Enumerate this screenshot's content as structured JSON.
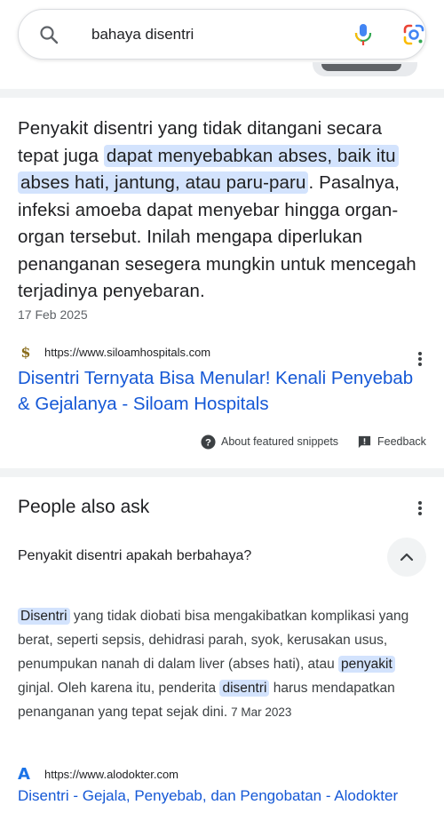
{
  "search": {
    "query": "bahaya disentri",
    "search_icon": "search-icon",
    "mic_icon": "mic-icon",
    "lens_icon": "google-lens-icon"
  },
  "snippet": {
    "before": "Penyakit disentri yang tidak ditangani secara tepat juga ",
    "highlight": "dapat menyebabkan abses, baik itu abses hati, jantung, atau paru-paru",
    "after": ". Pasalnya, infeksi amoeba dapat menyebar hingga organ-organ tersebut. Inilah mengapa diperlukan penanganan sesegera mungkin untuk mencegah terjadinya penyebaran.",
    "date": "17 Feb 2025"
  },
  "result1": {
    "favicon": "$",
    "url": "https://www.siloamhospitals.com",
    "title": "Disentri Ternyata Bisa Menular! Kenali Penyebab & Gejalanya - Siloam Hospitals"
  },
  "footer_links": {
    "about": "About featured snippets",
    "feedback": "Feedback"
  },
  "paa": {
    "title": "People also ask",
    "question": "Penyakit disentri apakah berbahaya?",
    "answer": {
      "hl1": "Disentri",
      "t1": " yang tidak diobati bisa mengakibatkan komplikasi yang berat, seperti sepsis, dehidrasi parah, syok, kerusakan usus, penumpukan nanah di dalam liver (abses hati), atau ",
      "hl2": "penyakit",
      "t2": " ginjal. Oleh karena itu, penderita ",
      "hl3": "disentri",
      "t3": " harus mendapatkan penanganan yang tepat sejak dini.",
      "date": "7 Mar 2023"
    }
  },
  "result2": {
    "favicon": "A",
    "url": "https://www.alodokter.com",
    "title": "Disentri - Gejala, Penyebab, dan Pengobatan - Alodokter"
  },
  "colors": {
    "link": "#1558d6",
    "highlight": "#d3e3fd",
    "divider": "#f1f3f4"
  }
}
